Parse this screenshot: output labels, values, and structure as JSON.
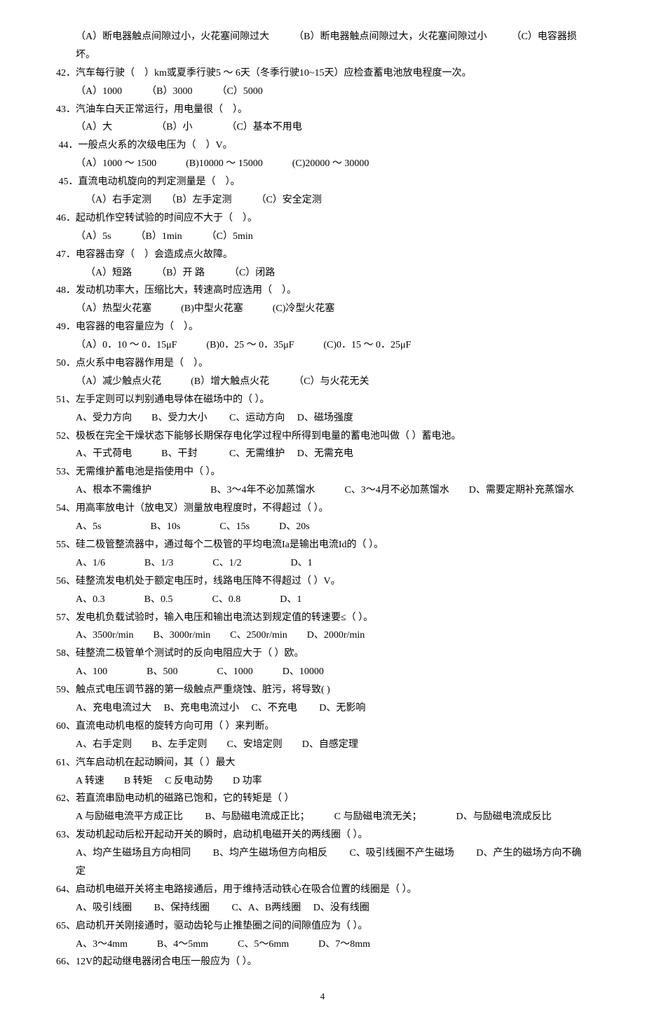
{
  "lines": [
    {
      "cls": "indent1",
      "t": "（A）断电器触点间隙过小，火花塞间隙过大　　　（B）断电器触点间隙过大，火花塞间隙过小　　　（C）电容器损坏。"
    },
    {
      "cls": "indent0",
      "t": "42．汽车每行驶（　）km或夏季行驶5 ～ 6天（冬季行驶10~15天）应检查蓄电池放电程度一次。"
    },
    {
      "cls": "indent1",
      "t": "（A）1000　　　（B）3000　　　（C）5000"
    },
    {
      "cls": "indent0",
      "t": "43．汽油车白天正常运行，用电量很（　）。"
    },
    {
      "cls": "indent1",
      "t": "（A）大　　　　　（B）小　　　　（C）基本不用电"
    },
    {
      "cls": "indent0",
      "t": " 44．一般点火系的次级电压为（　）V。"
    },
    {
      "cls": "indent1",
      "t": "（A）1000 ～ 1500　　　(B)10000 ～ 15000　　　(C)20000 ～ 30000"
    },
    {
      "cls": "indent0",
      "t": " 45．直流电动机旋向的判定测量是（　）。"
    },
    {
      "cls": "indent2",
      "t": "（A）右手定测　　（B）左手定测　　　（C）安全定测"
    },
    {
      "cls": "indent0",
      "t": "46．起动机作空转试验的时间应不大于（　）。"
    },
    {
      "cls": "indent1",
      "t": "（A）5s　　　（B）1min　　　（C）5min"
    },
    {
      "cls": "indent0",
      "t": "47．电容器击穿（　）会造成点火故障。"
    },
    {
      "cls": "indent2",
      "t": "（A）短路　　　（B）开 路　　　（C）闭路"
    },
    {
      "cls": "indent0",
      "t": "48．发动机功率大，压缩比大，转速高时应选用（　）。"
    },
    {
      "cls": "indent1",
      "t": "（A）热型火花塞　　　(B)中型火花塞　　　(C)冷型火花塞"
    },
    {
      "cls": "indent0",
      "t": "49．电容器的电容量应为（　）。"
    },
    {
      "cls": "indent1",
      "t": "（A）0．10 ～ 0．15μF　　　(B)0．25 ～ 0．35μF　　　(C)0．15 ～ 0．25μF"
    },
    {
      "cls": "indent0",
      "t": "50．点火系中电容器作用是（　）。"
    },
    {
      "cls": "indent1",
      "t": "（A）减少触点火花　　　(B）增大触点火花　　　（C）与火花无关"
    },
    {
      "cls": "indent0",
      "t": "51、左手定则可以判别通电导体在磁场中的（ ）。"
    },
    {
      "cls": "indent1",
      "t": "A、受力方向　　B、受力大小　　 C、运动方向　 D、磁场强度"
    },
    {
      "cls": "indent0",
      "t": "52、极板在完全干燥状态下能够长期保存电化学过程中所得到电量的蓄电池叫做（ ）蓄电池。"
    },
    {
      "cls": "indent1",
      "t": "A、干式荷电　　　B、干封　　　 C、无需维护　 D、无需充电"
    },
    {
      "cls": "indent0",
      "t": "53、无需维护蓄电池是指使用中（ ）。"
    },
    {
      "cls": "indent1",
      "t": "A、根本不需维护　　　　　　B、3～4年不必加蒸馏水　　　C、3～4月不必加蒸馏水　　D、需要定期补充蒸馏水"
    },
    {
      "cls": "indent0",
      "t": "54、用高率放电计（放电叉）测量放电程度时，不得超过（ ）。"
    },
    {
      "cls": "indent1",
      "t": "A、5s　　　　　B、10s　　　　C、15s　　　D、20s"
    },
    {
      "cls": "indent0",
      "t": "55、硅二极管整流器中，通过每个二极管的平均电流Ia是输出电流Id的（ ）。"
    },
    {
      "cls": "indent1",
      "t": "A、1/6　　　　B、1/3　　　　C、1/2　　　　　D、1"
    },
    {
      "cls": "indent0",
      "t": "56、硅整流发电机处于额定电压时，线路电压降不得超过（ ）V。"
    },
    {
      "cls": "indent1",
      "t": "A、0.3　　　　B、0.5　　　　C、0.8　　　　D、1"
    },
    {
      "cls": "indent0",
      "t": "57、发电机负载试验时，输入电压和输出电流达到规定值的转速要≤（ ）。"
    },
    {
      "cls": "indent1",
      "t": "A、3500r/min　　B、3000r/min　　C、2500r/min　　D、2000r/min"
    },
    {
      "cls": "indent0",
      "t": "58、硅整流二极管单个测试时的反向电阻应大于（ ）欧。"
    },
    {
      "cls": "indent1",
      "t": "A、100　　　　B、500　　　　C、1000　　　D、10000"
    },
    {
      "cls": "indent0",
      "t": "59、触点式电压调节器的第一级触点严重烧蚀、脏污，将导致( )"
    },
    {
      "cls": "indent1",
      "t": "A、充电电流过大　 B、充电电流过小　 C、不充电　　 D、无影响"
    },
    {
      "cls": "indent0",
      "t": "60、直流电动机电枢的旋转方向可用（ ）来判断。"
    },
    {
      "cls": "indent1",
      "t": "A、右手定则　　B、左手定则　　C、安培定则　　D、自感定理"
    },
    {
      "cls": "indent0",
      "t": "61、汽车启动机在起动瞬间，其（ ）最大"
    },
    {
      "cls": "indent1",
      "t": "A 转速　　B 转矩　 C 反电动势　　D 功率"
    },
    {
      "cls": "indent0",
      "t": "62、若直流串励电动机的磁路已饱和，它的转矩是（ ）"
    },
    {
      "cls": "indent1",
      "t": "A 与励磁电流平方成正比　　 B、与励磁电流成正比；　　　C 与励磁电流无关；　　　　D、与励磁电流成反比"
    },
    {
      "cls": "indent0",
      "t": "63、发动机起动后松开起动开关的瞬时，启动机电磁开关的两线圈（ ）。"
    },
    {
      "cls": "indent1",
      "t": "A、均产生磁场且方向相同　　 B、均产生磁场但方向相反　　 C、吸引线圈不产生磁场　　 D、产生的磁场方向不确定"
    },
    {
      "cls": "indent0",
      "t": "64、启动机电磁开关将主电路接通后，用于维持活动铁心在吸合位置的线圈是（ ）。"
    },
    {
      "cls": "indent1",
      "t": "A、吸引线圈　　 B、保持线圈　　 C、A、B两线圈　 D、没有线圈"
    },
    {
      "cls": "indent0",
      "t": "65、启动机开关刚接通时，驱动齿轮与止推垫圈之间的间隙值应为（ ）。"
    },
    {
      "cls": "indent1",
      "t": "A、3～4mm　　　B、4～5mm　　　C、5～6mm　　　D、7～8mm"
    },
    {
      "cls": "indent0",
      "t": "66、12V的起动继电器闭合电压一般应为（ ）。"
    }
  ],
  "pageNumber": "4"
}
